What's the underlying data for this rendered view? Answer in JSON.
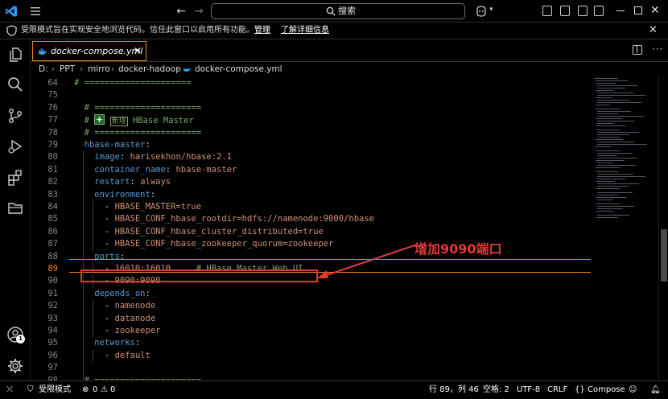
{
  "titlebar": {
    "search_label": "搜索"
  },
  "infobar": {
    "message": "受限模式旨在实现安全地浏览代码。信任此窗口以启用所有功能。",
    "manage_link": "管理",
    "learn_more_link": "了解详细信息"
  },
  "tab": {
    "label": "docker-compose.yml"
  },
  "breadcrumb": [
    "D:",
    "PPT",
    "mirro",
    "docker-hadoop",
    "docker-compose.yml"
  ],
  "editor": {
    "current_line": 89,
    "lines": [
      {
        "n": "64",
        "segs": [
          {
            "t": "# =====================",
            "c": "c-com"
          }
        ]
      },
      {
        "n": "75",
        "segs": []
      },
      {
        "n": "76",
        "segs": [
          {
            "t": "  # =====================",
            "c": "c-com"
          }
        ]
      },
      {
        "n": "77",
        "segs": [
          {
            "t": "  # ",
            "c": "c-com"
          },
          {
            "t": "HBase Master",
            "c": "c-com",
            "emoji": true
          }
        ]
      },
      {
        "n": "78",
        "segs": [
          {
            "t": "  # =====================",
            "c": "c-com"
          }
        ]
      },
      {
        "n": "79",
        "segs": [
          {
            "t": "  hbase-master",
            "c": "c-key"
          },
          {
            "t": ":",
            "c": "c-punc"
          }
        ]
      },
      {
        "n": "80",
        "segs": [
          {
            "t": "    image",
            "c": "c-key"
          },
          {
            "t": ": ",
            "c": "c-punc"
          },
          {
            "t": "harisekhon/hbase:2.1",
            "c": "c-val"
          }
        ]
      },
      {
        "n": "81",
        "segs": [
          {
            "t": "    container_name",
            "c": "c-key"
          },
          {
            "t": ": ",
            "c": "c-punc"
          },
          {
            "t": "hbase-master",
            "c": "c-val"
          }
        ]
      },
      {
        "n": "82",
        "segs": [
          {
            "t": "    restart",
            "c": "c-key"
          },
          {
            "t": ": ",
            "c": "c-punc"
          },
          {
            "t": "always",
            "c": "c-val"
          }
        ]
      },
      {
        "n": "83",
        "segs": [
          {
            "t": "    environment",
            "c": "c-key"
          },
          {
            "t": ":",
            "c": "c-punc"
          }
        ]
      },
      {
        "n": "84",
        "segs": [
          {
            "t": "      - ",
            "c": "c-punc"
          },
          {
            "t": "HBASE_MASTER=true",
            "c": "c-val"
          }
        ]
      },
      {
        "n": "85",
        "segs": [
          {
            "t": "      - ",
            "c": "c-punc"
          },
          {
            "t": "HBASE_CONF_hbase_rootdir=hdfs://namenode:9000/hbase",
            "c": "c-val"
          }
        ]
      },
      {
        "n": "86",
        "segs": [
          {
            "t": "      - ",
            "c": "c-punc"
          },
          {
            "t": "HBASE_CONF_hbase_cluster_distributed=true",
            "c": "c-val"
          }
        ]
      },
      {
        "n": "87",
        "segs": [
          {
            "t": "      - ",
            "c": "c-punc"
          },
          {
            "t": "HBASE_CONF_hbase_zookeeper_quorum=zookeeper",
            "c": "c-val"
          }
        ]
      },
      {
        "n": "88",
        "segs": [
          {
            "t": "    ports",
            "c": "c-key"
          },
          {
            "t": ":",
            "c": "c-punc"
          }
        ]
      },
      {
        "n": "89",
        "segs": [
          {
            "t": "      - ",
            "c": "c-punc"
          },
          {
            "t": "16010:16010",
            "c": "c-val"
          },
          {
            "t": "     # HBase Master Web UI",
            "c": "c-com"
          }
        ]
      },
      {
        "n": "90",
        "segs": [
          {
            "t": "      - ",
            "c": "c-punc"
          },
          {
            "t": "9090:9090",
            "c": "c-val"
          }
        ]
      },
      {
        "n": "91",
        "segs": [
          {
            "t": "    depends_on",
            "c": "c-key"
          },
          {
            "t": ":",
            "c": "c-punc"
          }
        ]
      },
      {
        "n": "92",
        "segs": [
          {
            "t": "      - ",
            "c": "c-punc"
          },
          {
            "t": "namenode",
            "c": "c-val"
          }
        ]
      },
      {
        "n": "93",
        "segs": [
          {
            "t": "      - ",
            "c": "c-punc"
          },
          {
            "t": "datanode",
            "c": "c-val"
          }
        ]
      },
      {
        "n": "94",
        "segs": [
          {
            "t": "      - ",
            "c": "c-punc"
          },
          {
            "t": "zookeeper",
            "c": "c-val"
          }
        ]
      },
      {
        "n": "95",
        "segs": [
          {
            "t": "    networks",
            "c": "c-key"
          },
          {
            "t": ":",
            "c": "c-punc"
          }
        ]
      },
      {
        "n": "96",
        "segs": [
          {
            "t": "      - ",
            "c": "c-punc"
          },
          {
            "t": "default",
            "c": "c-val"
          }
        ]
      },
      {
        "n": "97",
        "segs": []
      },
      {
        "n": "98",
        "segs": [
          {
            "t": "  # =====================",
            "c": "c-com"
          }
        ]
      }
    ],
    "emoji_label": "新增"
  },
  "annotation": {
    "text": "增加9090端口",
    "color": "#e53935"
  },
  "statusbar": {
    "restricted_mode": "受限模式",
    "errors": "0",
    "warnings": "0",
    "cursor": "行 89，列 46",
    "indent": "空格: 2",
    "encoding": "UTF-8",
    "eol": "CRLF",
    "language": "Compose"
  },
  "colors": {
    "accent": "#f38518",
    "background": "#000000",
    "annotation": "#e53935"
  }
}
